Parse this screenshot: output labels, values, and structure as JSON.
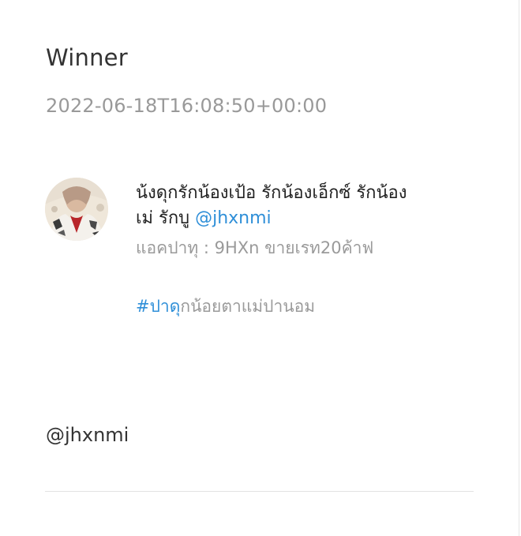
{
  "title": "Winner",
  "timestamp": "2022-06-18T16:08:50+00:00",
  "post": {
    "line1": "น้งดุกรักน้องเป้อ รักน้องเอ็กซ์ รักน้อง",
    "line2_prefix": "เม่ รักบู ",
    "line2_mention": "@jhxnmi",
    "sub_text": "แอคปาทุ : 9HXn ขายเรท20ค้าฟ",
    "hashtag": "#ปาดุ",
    "hashtag_suffix": "กน้อยตาแม่ปานอม",
    "avatar_icon": "profile-photo"
  },
  "footer": {
    "mention": "@jhxnmi"
  },
  "colors": {
    "link": "#2f8fd8",
    "muted": "#999999",
    "text": "#333333"
  }
}
